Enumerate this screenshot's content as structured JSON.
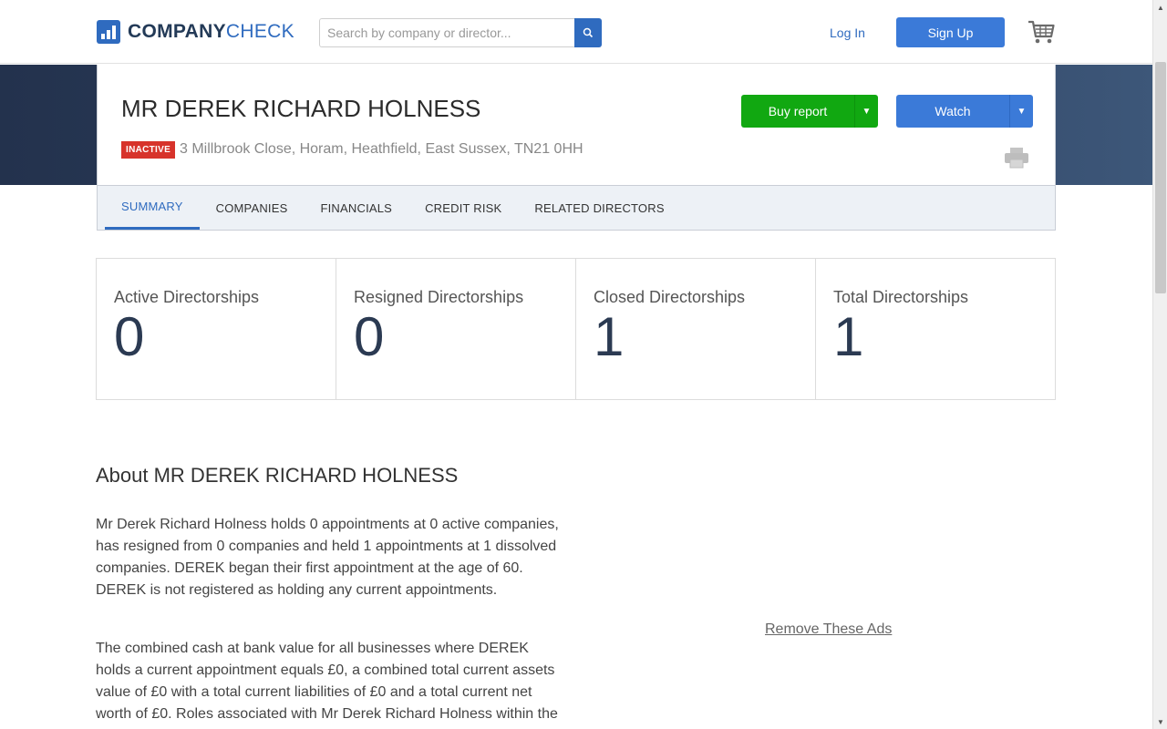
{
  "header": {
    "logo_bold": "COMPANY",
    "logo_light": "CHECK",
    "search_placeholder": "Search by company or director...",
    "login_label": "Log In",
    "signup_label": "Sign Up"
  },
  "profile": {
    "name": "MR DEREK RICHARD HOLNESS",
    "status_badge": "INACTIVE",
    "address": "3 Millbrook Close, Horam, Heathfield, East Sussex, TN21 0HH",
    "buy_report_label": "Buy report",
    "watch_label": "Watch"
  },
  "tabs": [
    {
      "label": "SUMMARY",
      "active": true
    },
    {
      "label": "COMPANIES",
      "active": false
    },
    {
      "label": "FINANCIALS",
      "active": false
    },
    {
      "label": "CREDIT RISK",
      "active": false
    },
    {
      "label": "RELATED DIRECTORS",
      "active": false
    }
  ],
  "stats": [
    {
      "label": "Active Directorships",
      "value": "0"
    },
    {
      "label": "Resigned Directorships",
      "value": "0"
    },
    {
      "label": "Closed Directorships",
      "value": "1"
    },
    {
      "label": "Total Directorships",
      "value": "1"
    }
  ],
  "about": {
    "title": "About MR DEREK RICHARD HOLNESS",
    "paragraph1": "Mr Derek Richard Holness holds 0 appointments at 0 active companies, has resigned from 0 companies and held 1 appointments at 1 dissolved companies. DEREK began their first appointment at the age of 60. DEREK is not registered as holding any current appointments.",
    "paragraph2": "The combined cash at bank value for all businesses where DEREK holds a current appointment equals £0, a combined total current assets value of £0 with a total current liabilities of £0 and a total current net worth of £0. Roles associated with Mr Derek Richard Holness within the"
  },
  "ads": {
    "remove_label": "Remove These Ads"
  },
  "colors": {
    "brand_blue": "#2f6bbf",
    "buy_green": "#11a811",
    "inactive_red": "#d7332b"
  }
}
